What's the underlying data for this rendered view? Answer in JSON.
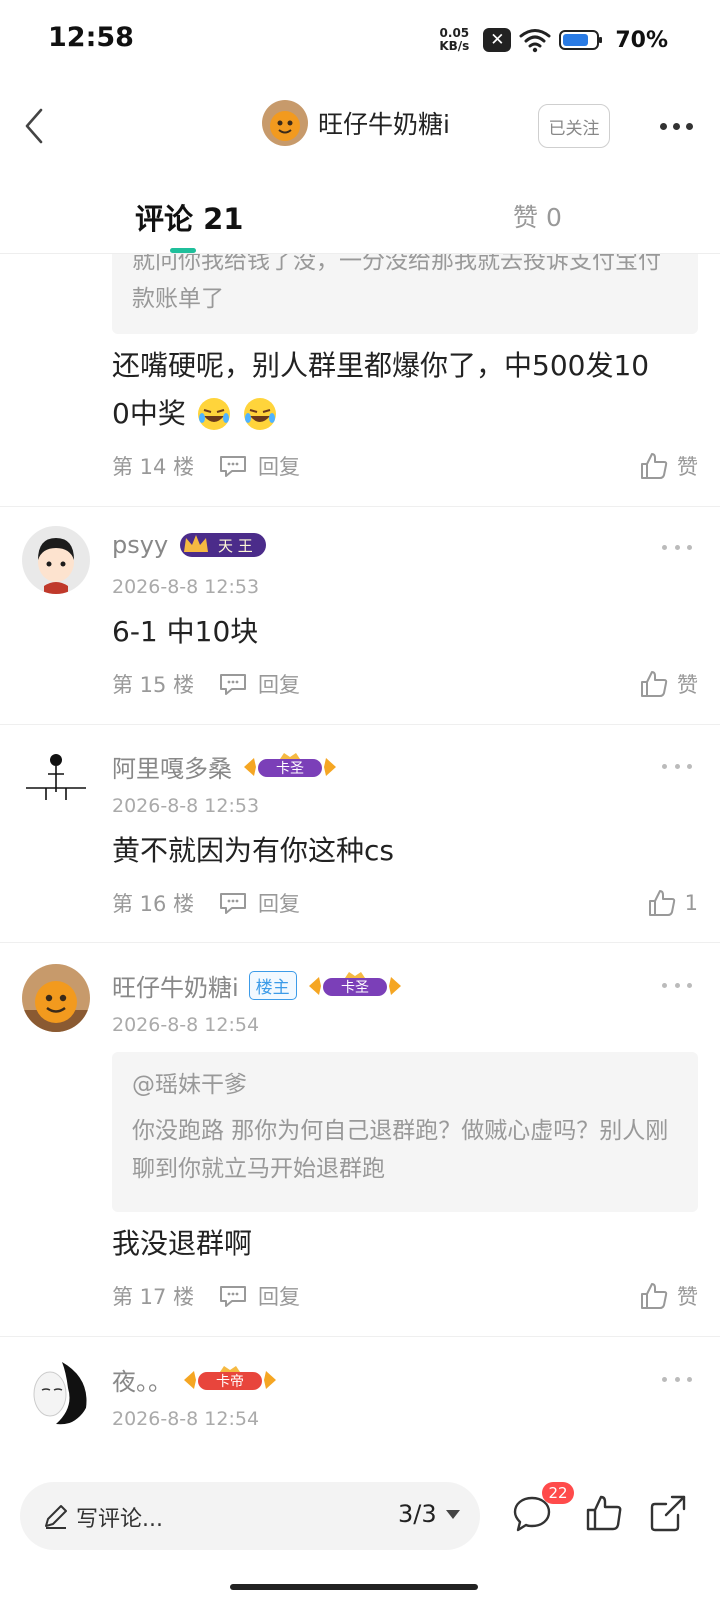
{
  "status_bar": {
    "time": "12:58",
    "net_speed": "0.05",
    "net_unit": "KB/s",
    "battery": "70%"
  },
  "header": {
    "username": "旺仔牛奶糖i",
    "follow_label": "已关注"
  },
  "tabs": {
    "comments": "评论 21",
    "likes": "赞 0"
  },
  "comments": [
    {
      "quote": "就问你我给钱了没，一分没给那我就去投诉支付宝付款账单了",
      "text_line1": "还嘴硬呢，别人群里都爆你了，中500发10",
      "text_line2": "0中奖",
      "floor": "第 14 楼",
      "reply": "回复",
      "like": "赞"
    },
    {
      "name": "psyy",
      "badge": "天 王",
      "time": "2026-8-8 12:53",
      "text": "6-1 中10块",
      "floor": "第 15 楼",
      "reply": "回复",
      "like": "赞"
    },
    {
      "name": "阿里嘎多桑",
      "badge": "卡圣",
      "time": "2026-8-8 12:53",
      "text": "黄不就因为有你这种cs",
      "floor": "第 16 楼",
      "reply": "回复",
      "like": "1"
    },
    {
      "name": "旺仔牛奶糖i",
      "owner_tag": "楼主",
      "badge": "卡圣",
      "time": "2026-8-8 12:54",
      "quote_user": "@瑶妹干爹",
      "quote": "你没跑路 那你为何自己退群跑？做贼心虚吗？别人刚聊到你就立马开始退群跑",
      "text": "我没退群啊",
      "floor": "第 17 楼",
      "reply": "回复",
      "like": "赞"
    },
    {
      "name": "夜。。",
      "badge": "卡帝",
      "time": "2026-8-8 12:54"
    }
  ],
  "bottom_bar": {
    "placeholder": "写评论...",
    "page": "3/3",
    "comment_count": "22"
  },
  "colors": {
    "accent": "#1fbf9b",
    "badge_red": "#ff4b4b",
    "owner_blue": "#3c9be8"
  }
}
